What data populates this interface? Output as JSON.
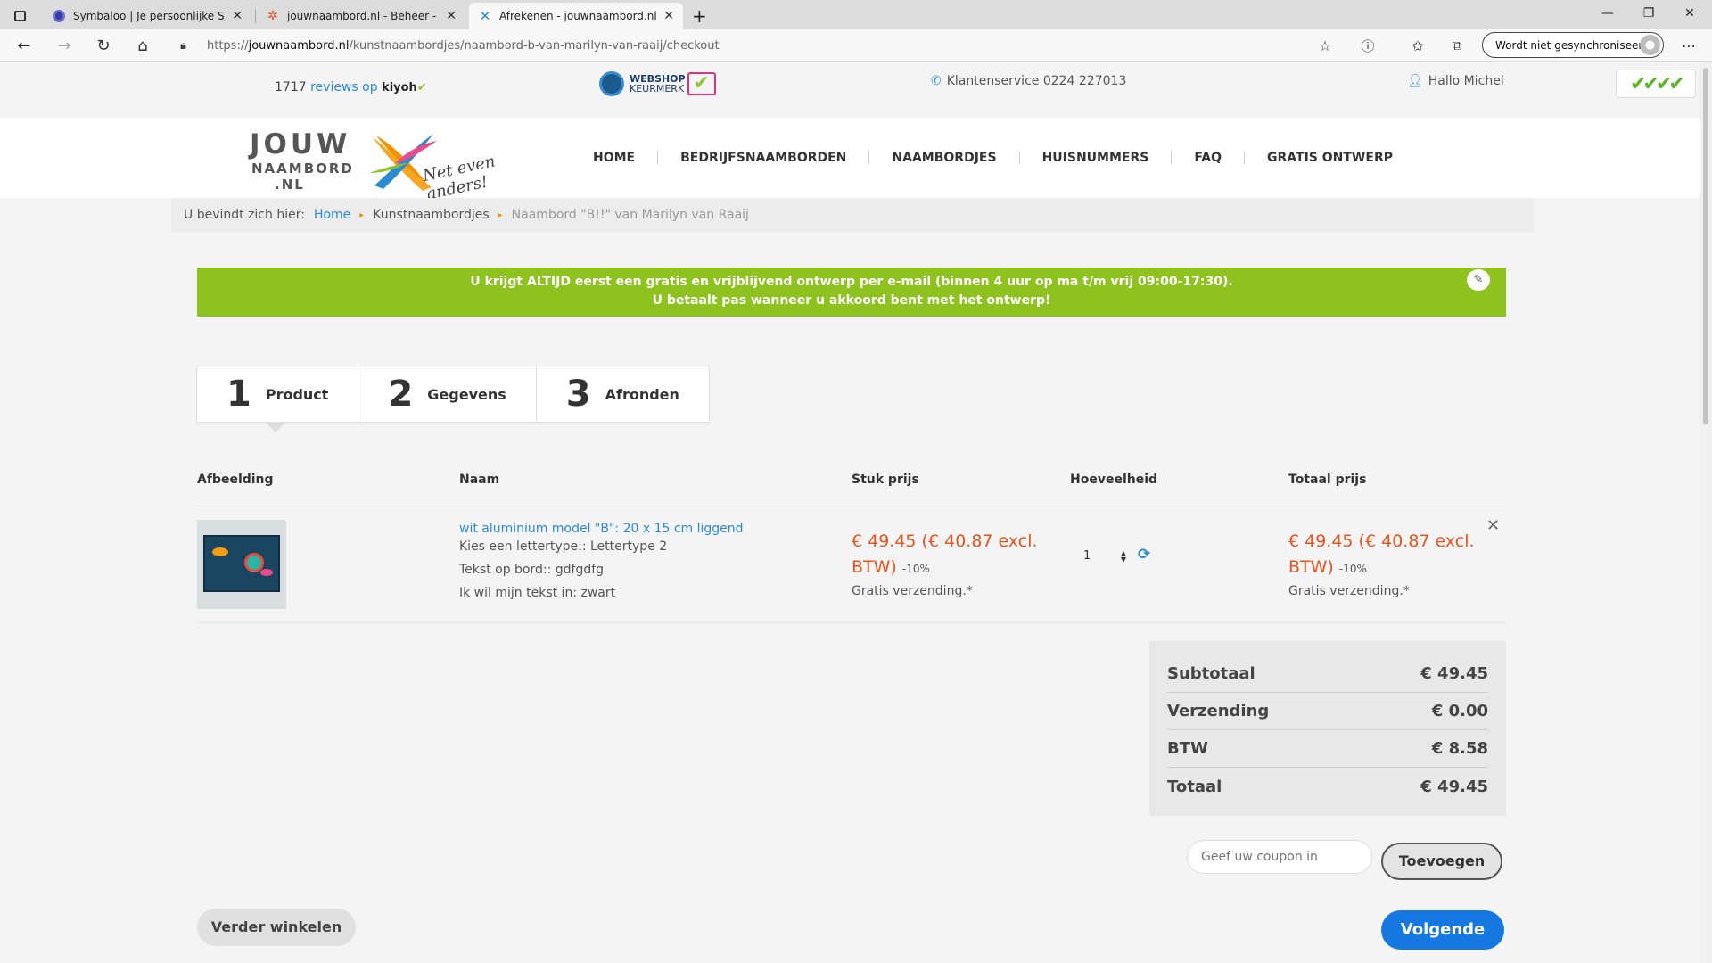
{
  "browser": {
    "tabs": [
      {
        "title": "Symbaloo | Je persoonlijke Startpagina",
        "icon": "symbaloo-icon"
      },
      {
        "title": "jouwnaambord.nl - Beheer - Dashboard",
        "icon": "joomla-icon"
      },
      {
        "title": "Afrekenen - jouwnaambord.nl",
        "icon": "jouwnaambord-icon"
      }
    ],
    "url_prefix": "https://",
    "url_host": "jouwnaambord.nl",
    "url_path": "/kunstnaambordjes/naambord-b-van-marilyn-van-raaij/checkout",
    "sync_label": "Wordt niet gesynchroniseerd"
  },
  "topbar": {
    "reviews_count": "1717",
    "reviews_text": "reviews op",
    "reviews_brand": "kiyoh",
    "keurmerk_line1": "WEBSHOP",
    "keurmerk_line2": "KEURMERK",
    "service": "Klantenservice 0224 227013",
    "greeting": "Hallo Michel",
    "checks": "✔✔✔✔"
  },
  "logo": {
    "line1": "JOUW",
    "line2": "NAAMBORD",
    "line3": ".NL",
    "slogan": "Net even anders!"
  },
  "nav": [
    "HOME",
    "BEDRIJFSNAAMBORDEN",
    "NAAMBORDJES",
    "HUISNUMMERS",
    "FAQ",
    "GRATIS ONTWERP"
  ],
  "breadcrumb": {
    "prefix": "U bevindt zich hier:",
    "home": "Home",
    "category": "Kunstnaambordjes",
    "current": "Naambord \"B!!\" van Marilyn van Raaij"
  },
  "banner": {
    "line1": "U krijgt ALTIJD eerst een gratis en vrijblijvend ontwerp per e-mail (binnen 4 uur op ma t/m vrij 09:00-17:30).",
    "line2": "U betaalt pas wanneer u akkoord bent met het ontwerp!"
  },
  "steps": [
    {
      "num": "1",
      "label": "Product"
    },
    {
      "num": "2",
      "label": "Gegevens"
    },
    {
      "num": "3",
      "label": "Afronden"
    }
  ],
  "table": {
    "headers": [
      "Afbeelding",
      "Naam",
      "Stuk prijs",
      "Hoeveelheid",
      "Totaal prijs"
    ],
    "item": {
      "name": "wit aluminium model \"B\": 20 x 15 cm liggend",
      "options": [
        "Kies een lettertype:: Lettertype 2",
        "Tekst op bord:: gdfgdfg",
        "Ik wil mijn tekst in: zwart"
      ],
      "unit_price_line1": "€ 49.45 (€ 40.87 excl.",
      "unit_price_line2": "BTW)",
      "unit_discount": "-10%",
      "unit_shipping": "Gratis verzending.*",
      "quantity": "1",
      "total_price_line1": "€ 49.45 (€ 40.87 excl.",
      "total_price_line2": "BTW)",
      "total_discount": "-10%",
      "total_shipping": "Gratis verzending.*"
    }
  },
  "totals": [
    {
      "label": "Subtotaal",
      "value": "€ 49.45"
    },
    {
      "label": "Verzending",
      "value": "€ 0.00"
    },
    {
      "label": "BTW",
      "value": "€ 8.58"
    },
    {
      "label": "Totaal",
      "value": "€ 49.45"
    }
  ],
  "coupon": {
    "placeholder": "Geef uw coupon in",
    "button": "Toevoegen"
  },
  "actions": {
    "back": "Verder winkelen",
    "next": "Volgende"
  },
  "colors": {
    "accent_blue": "#2a8ad4",
    "banner_green": "#8dc21f",
    "price_orange": "#e6551e",
    "next_button": "#1478e0"
  }
}
